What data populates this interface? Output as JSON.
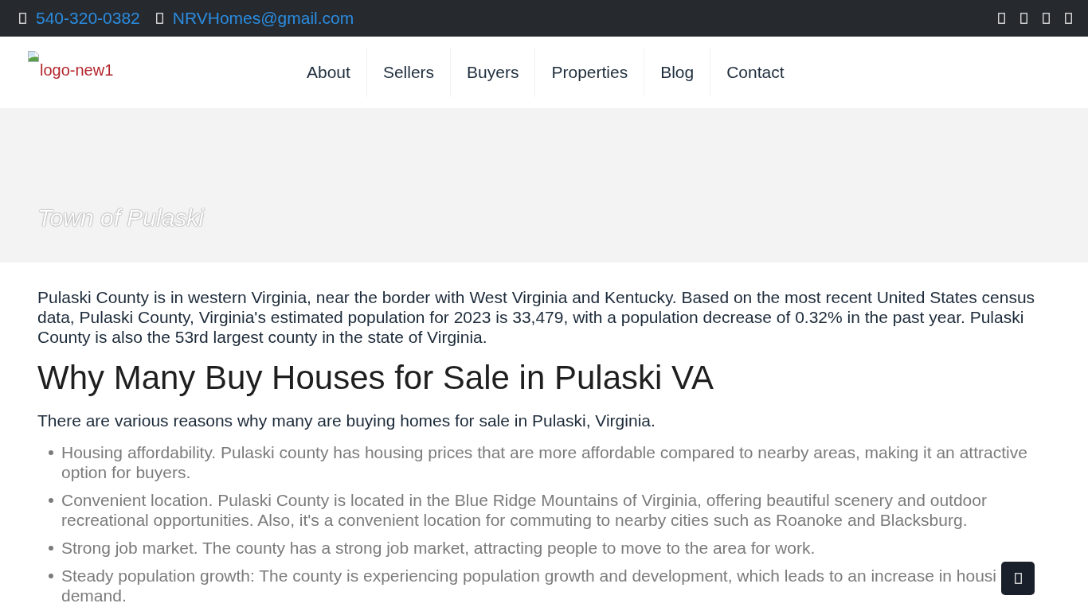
{
  "top_bar": {
    "phone": "540-320-0382",
    "email": "NRVHomes@gmail.com"
  },
  "header": {
    "logo_alt": "logo-new1",
    "nav": [
      "About",
      "Sellers",
      "Buyers",
      "Properties",
      "Blog",
      "Contact"
    ]
  },
  "hero": {
    "title": "Town of Pulaski"
  },
  "content": {
    "intro": "Pulaski County is in western Virginia, near the border with West Virginia and Kentucky. Based on the most recent United States census data, Pulaski County, Virginia's estimated population for 2023 is 33,479, with a population decrease of 0.32% in the past year. Pulaski County is also the 53rd largest county in the state of Virginia.",
    "heading": "Why Many Buy Houses for Sale in Pulaski VA",
    "lead": "There are various reasons why many are buying homes for sale in Pulaski, Virginia.",
    "bullets": [
      "Housing affordability. Pulaski county has housing prices that are more affordable compared to nearby areas, making it an attractive option for buyers.",
      "Convenient location. Pulaski County is located in the Blue Ridge Mountains of Virginia, offering beautiful scenery and outdoor recreational opportunities. Also, it's a convenient location for commuting to nearby cities such as Roanoke and Blacksburg.",
      "Strong job market. The county has a strong job market, attracting people to move to the area for work.",
      "Steady population growth: The county is experiencing population growth and development, which leads to an increase in housi demand."
    ]
  }
}
